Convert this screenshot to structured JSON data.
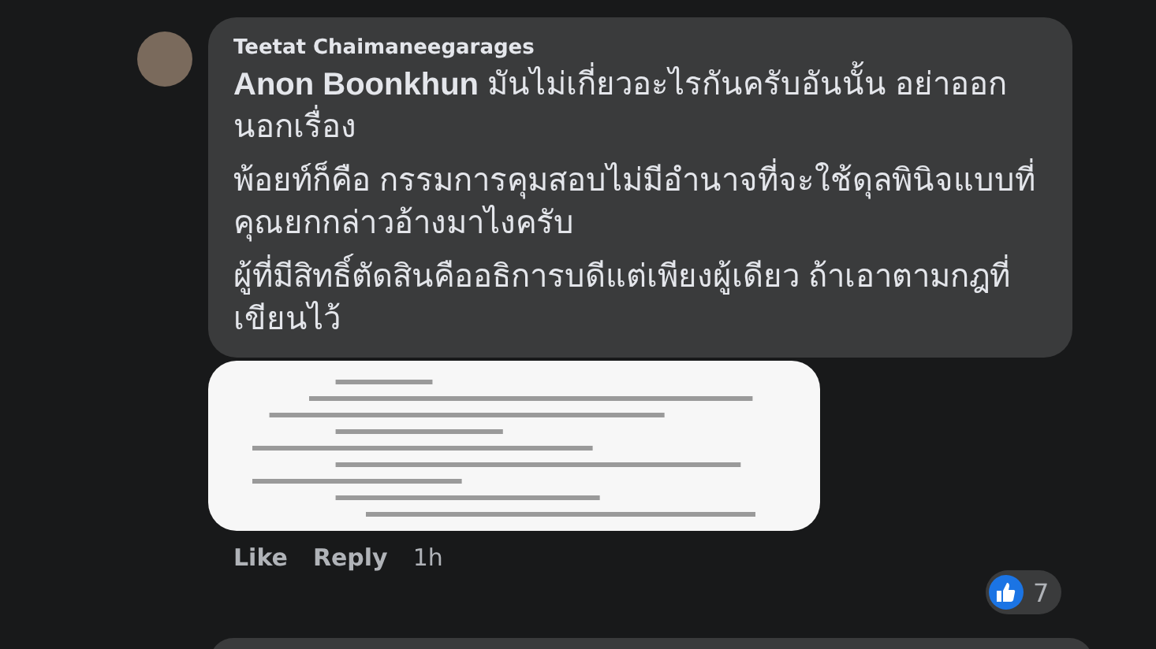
{
  "comment": {
    "author": "Teetat Chaimaneegarages",
    "paragraphs": [
      "**Anon Boonkhun** มันไม่เกี่ยวอะไรกันครับอันนั้น อย่าออกนอกเรื่อง",
      "พ้อยท์ก็คือ กรรมการคุมสอบไม่มีอำนาจที่จะใช้ดุลพินิจแบบที่คุณยกกล่าวอ้างมาไงครับ",
      "ผู้ที่มีสิทธิ์ตัดสินคืออธิการบดีแต่เพียงผู้เดียว ถ้าเอาตามกฎที่เขียนไว้"
    ],
    "actions": [
      {
        "label": "Like",
        "kind": "link"
      },
      {
        "label": "Reply",
        "kind": "link"
      },
      {
        "label": "1h",
        "kind": "time"
      }
    ],
    "reaction_count": "7"
  }
}
